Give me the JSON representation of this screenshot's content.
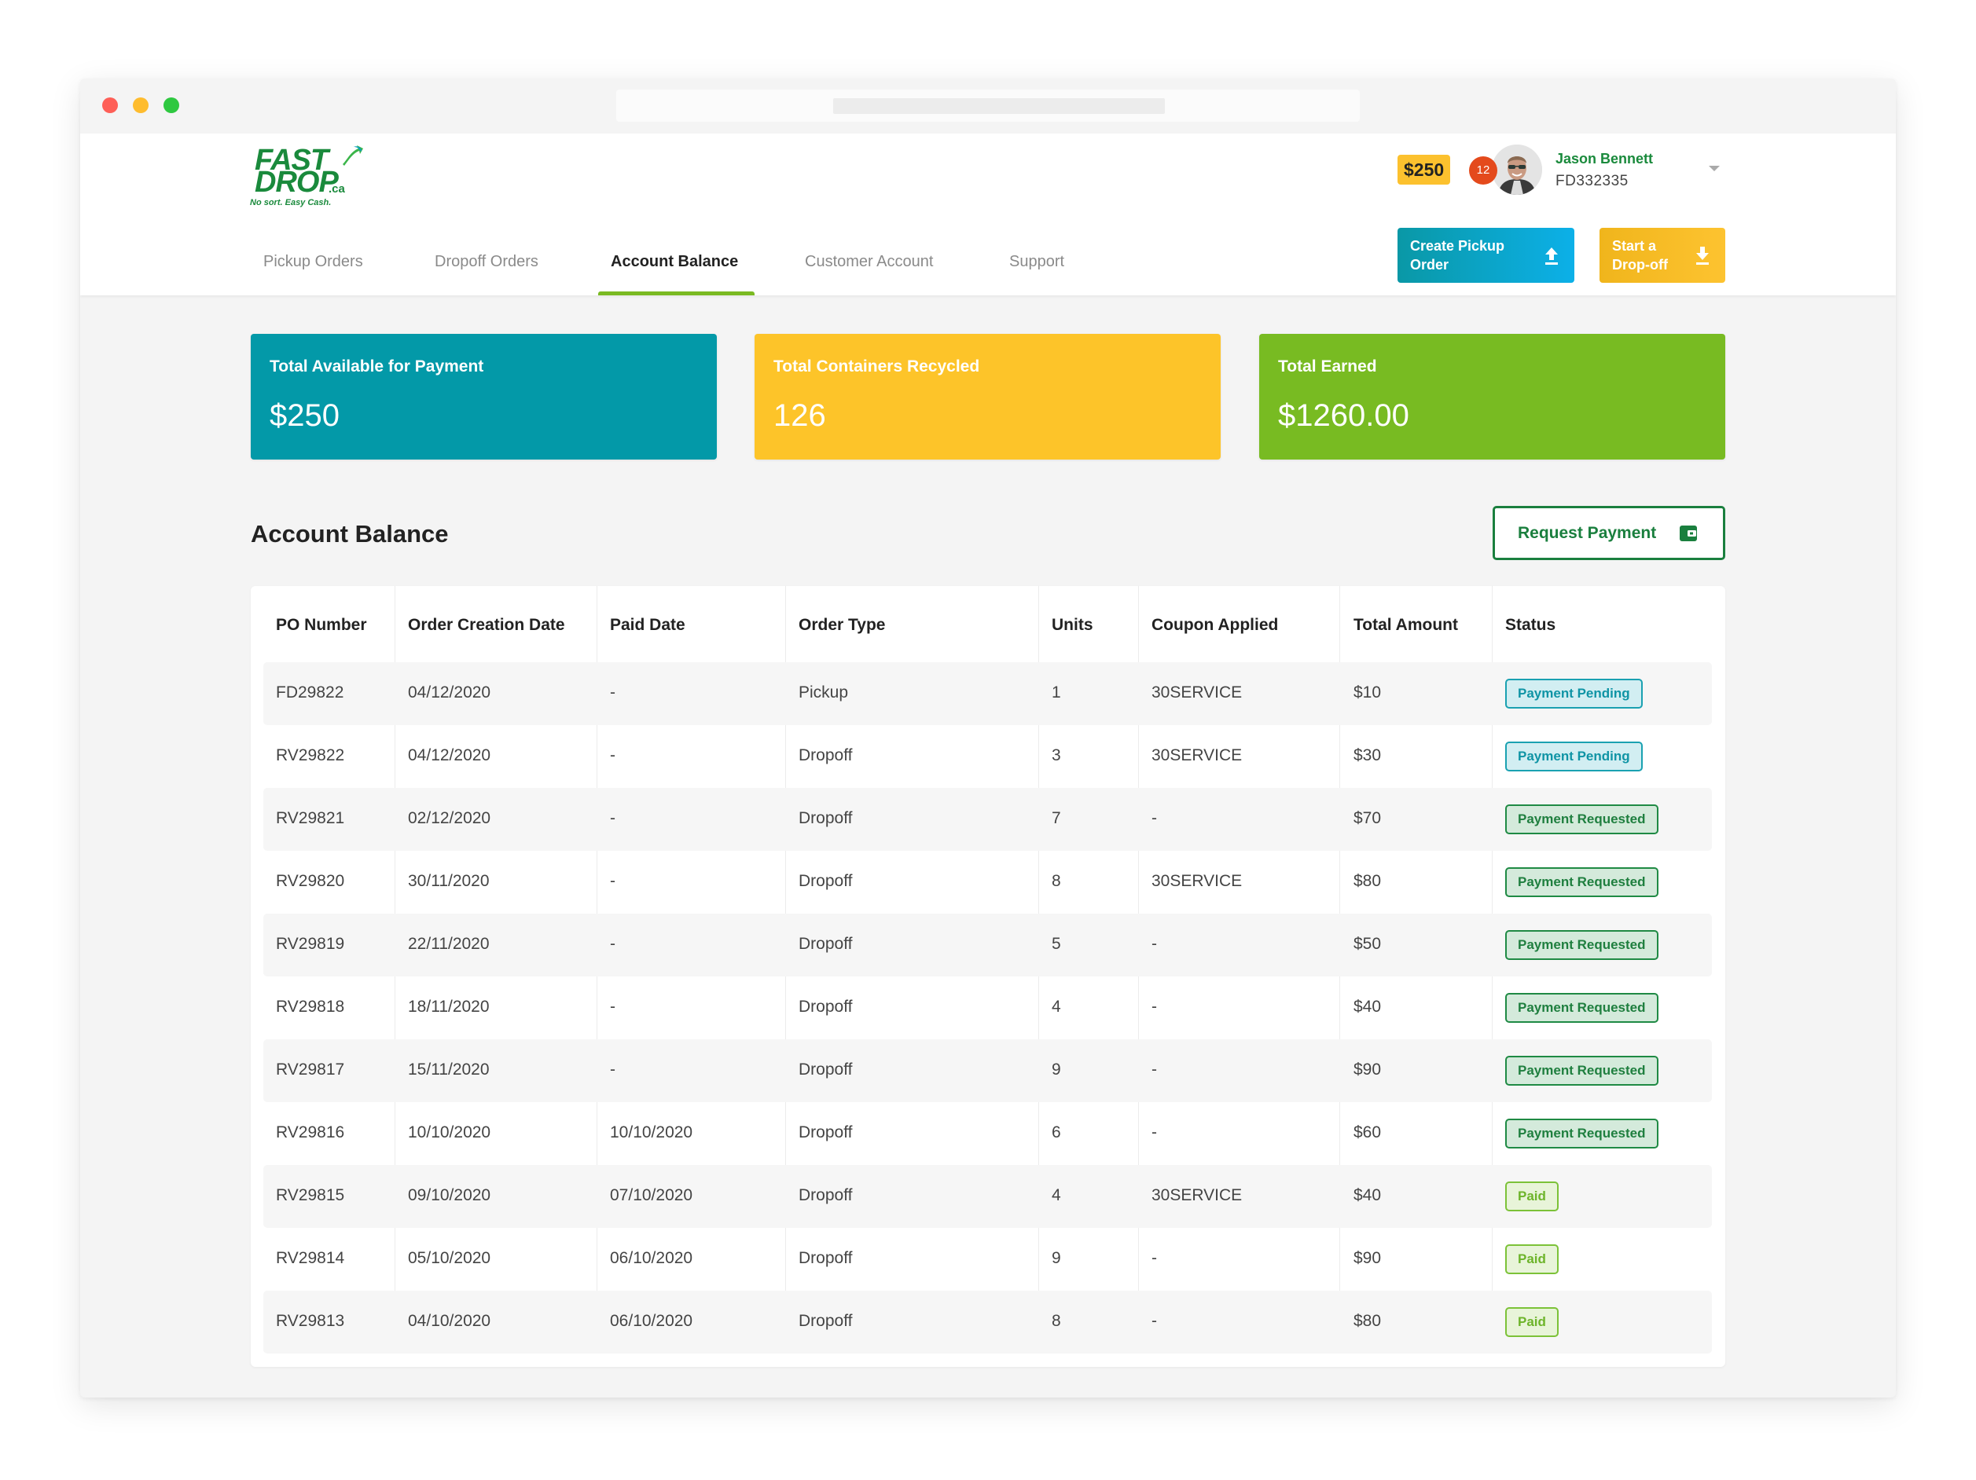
{
  "header": {
    "logo": {
      "line1": "FAST",
      "line2": "DROP",
      "suffix": ".ca",
      "tagline": "No sort. Easy Cash."
    },
    "balance_pill": "$250",
    "notification_count": "12",
    "user": {
      "name": "Jason Bennett",
      "id": "FD332335"
    },
    "nav_tabs": [
      {
        "label": "Pickup Orders",
        "active": false
      },
      {
        "label": "Dropoff Orders",
        "active": false
      },
      {
        "label": "Account Balance",
        "active": true
      },
      {
        "label": "Customer Account",
        "active": false
      },
      {
        "label": "Support",
        "active": false
      }
    ],
    "actions": {
      "create_pickup": {
        "line1": "Create Pickup",
        "line2": "Order",
        "icon": "upload-icon"
      },
      "start_dropoff": {
        "line1": "Start a",
        "line2": "Drop-off",
        "icon": "download-icon"
      }
    }
  },
  "summary_cards": [
    {
      "label": "Total Available for Payment",
      "value": "$250",
      "color": "#0399a8"
    },
    {
      "label": "Total Containers Recycled",
      "value": "126",
      "color": "#fdc429"
    },
    {
      "label": "Total Earned",
      "value": "$1260.00",
      "color": "#78bb22"
    }
  ],
  "section": {
    "title": "Account Balance",
    "request_payment_label": "Request Payment",
    "request_payment_icon": "wallet-icon"
  },
  "table": {
    "columns": [
      "PO Number",
      "Order Creation Date",
      "Paid Date",
      "Order Type",
      "Units",
      "Coupon Applied",
      "Total Amount",
      "Status"
    ],
    "rows": [
      {
        "po": "FD29822",
        "created": "04/12/2020",
        "paid": "-",
        "type": "Pickup",
        "units": "1",
        "coupon": "30SERVICE",
        "amount": "$10",
        "status": "Payment Pending",
        "status_kind": "pending"
      },
      {
        "po": "RV29822",
        "created": "04/12/2020",
        "paid": "-",
        "type": "Dropoff",
        "units": "3",
        "coupon": "30SERVICE",
        "amount": "$30",
        "status": "Payment Pending",
        "status_kind": "pending"
      },
      {
        "po": "RV29821",
        "created": "02/12/2020",
        "paid": "-",
        "type": "Dropoff",
        "units": "7",
        "coupon": "-",
        "amount": "$70",
        "status": "Payment Requested",
        "status_kind": "requested"
      },
      {
        "po": "RV29820",
        "created": "30/11/2020",
        "paid": "-",
        "type": "Dropoff",
        "units": "8",
        "coupon": "30SERVICE",
        "amount": "$80",
        "status": "Payment Requested",
        "status_kind": "requested"
      },
      {
        "po": "RV29819",
        "created": "22/11/2020",
        "paid": "-",
        "type": "Dropoff",
        "units": "5",
        "coupon": "-",
        "amount": "$50",
        "status": "Payment Requested",
        "status_kind": "requested"
      },
      {
        "po": "RV29818",
        "created": "18/11/2020",
        "paid": "-",
        "type": "Dropoff",
        "units": "4",
        "coupon": "-",
        "amount": "$40",
        "status": "Payment Requested",
        "status_kind": "requested"
      },
      {
        "po": "RV29817",
        "created": "15/11/2020",
        "paid": "-",
        "type": "Dropoff",
        "units": "9",
        "coupon": "-",
        "amount": "$90",
        "status": "Payment Requested",
        "status_kind": "requested"
      },
      {
        "po": "RV29816",
        "created": "10/10/2020",
        "paid": "10/10/2020",
        "type": "Dropoff",
        "units": "6",
        "coupon": "-",
        "amount": "$60",
        "status": "Payment Requested",
        "status_kind": "requested"
      },
      {
        "po": "RV29815",
        "created": "09/10/2020",
        "paid": "07/10/2020",
        "type": "Dropoff",
        "units": "4",
        "coupon": "30SERVICE",
        "amount": "$40",
        "status": "Paid",
        "status_kind": "paid"
      },
      {
        "po": "RV29814",
        "created": "05/10/2020",
        "paid": "06/10/2020",
        "type": "Dropoff",
        "units": "9",
        "coupon": "-",
        "amount": "$90",
        "status": "Paid",
        "status_kind": "paid"
      },
      {
        "po": "RV29813",
        "created": "04/10/2020",
        "paid": "06/10/2020",
        "type": "Dropoff",
        "units": "8",
        "coupon": "-",
        "amount": "$80",
        "status": "Paid",
        "status_kind": "paid"
      }
    ]
  },
  "colors": {
    "brand_green": "#1a8a3c",
    "accent_teal": "#0399a8",
    "accent_yellow": "#fdc429",
    "accent_lime": "#78bb22",
    "notification_red": "#e44a1c"
  }
}
